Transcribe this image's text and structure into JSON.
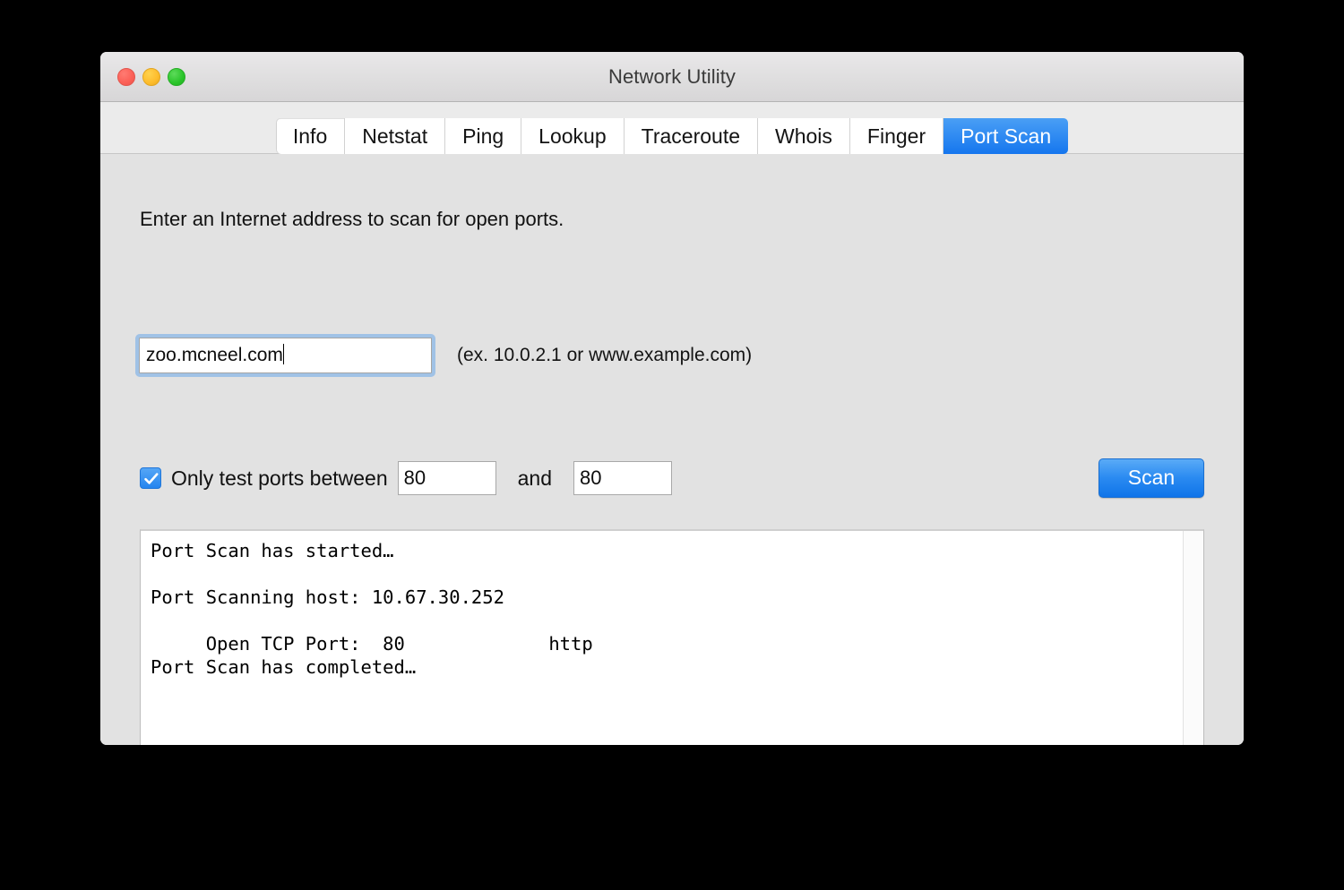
{
  "window": {
    "title": "Network Utility",
    "controls": {
      "close": "close-button",
      "minimize": "minimize-button",
      "maximize": "maximize-button"
    }
  },
  "tabs": [
    {
      "label": "Info",
      "active": false
    },
    {
      "label": "Netstat",
      "active": false
    },
    {
      "label": "Ping",
      "active": false
    },
    {
      "label": "Lookup",
      "active": false
    },
    {
      "label": "Traceroute",
      "active": false
    },
    {
      "label": "Whois",
      "active": false
    },
    {
      "label": "Finger",
      "active": false
    },
    {
      "label": "Port Scan",
      "active": true
    }
  ],
  "main": {
    "instruction": "Enter an Internet address to scan for open ports.",
    "address_field": {
      "value": "zoo.mcneel.com",
      "placeholder": "",
      "focused": true
    },
    "address_hint": "(ex. 10.0.2.1 or www.example.com)",
    "port_range": {
      "checkbox_checked": true,
      "checkbox_label": "Only test ports between",
      "from_value": "80",
      "and_label": "and",
      "to_value": "80"
    },
    "scan_button": "Scan",
    "console_output": "Port Scan has started…\n\nPort Scanning host: 10.67.30.252\n\n     Open TCP Port:  80             http\nPort Scan has completed…"
  },
  "colors": {
    "accent_blue": "#1576ee",
    "scan_button": "#2b8bf1",
    "checkbox_blue": "#2585ef",
    "window_chrome": "#e2e2e2",
    "toolbar": "#ebebeb",
    "titlebar_top": "#e9e8e9",
    "close_red": "#fb5f56",
    "minimize_yellow": "#fdbc2c",
    "maximize_green": "#2ac42a",
    "desktop": "#000000"
  }
}
